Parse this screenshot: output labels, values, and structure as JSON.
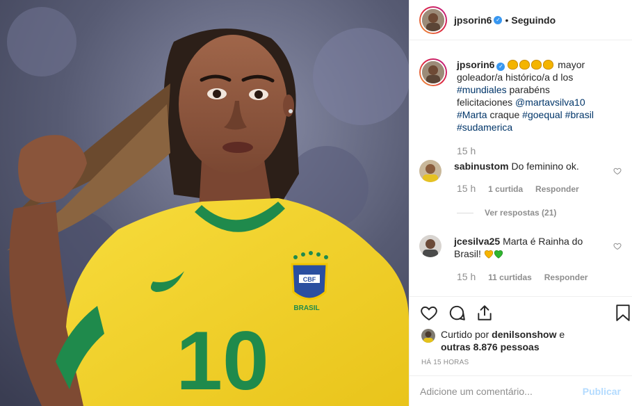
{
  "post": {
    "username": "jpsorin6",
    "verified_mark": "✓",
    "separator": "•",
    "follow_status": "Seguindo",
    "caption": {
      "username": "jpsorin6",
      "clap_count": 4,
      "text_1": " mayor goleador/a histórico/a d los ",
      "hashtag_mundiales": "#mundiales",
      "text_2": " parabéns felicitaciones ",
      "mention": "@martavsilva10",
      "hashtag_marta": " #Marta",
      "text_3": " craque ",
      "hashtag_goequal": "#goequal",
      "hashtag_brasil": " #brasil",
      "hashtag_sudamerica": " #sudamerica",
      "time": "15 h"
    }
  },
  "comments": [
    {
      "username": "sabinustom",
      "text": "Do feminino ok.",
      "time": "15 h",
      "likes": "1 curtida",
      "reply": "Responder",
      "view_replies": "Ver respostas (21)"
    },
    {
      "username": "jcesilva25",
      "text": "Marta é Rainha do Brasil!",
      "time": "15 h",
      "likes": "11 curtidas",
      "reply": "Responder"
    }
  ],
  "actions": {
    "liked_by_prefix": "Curtido por ",
    "liked_by_user": "denilsonshow",
    "liked_by_and": " e",
    "others": "outras 8.876 pessoas",
    "timestamp": "HÁ 15 HORAS"
  },
  "add_comment": {
    "placeholder": "Adicione um comentário...",
    "publish_label": "Publicar"
  },
  "photo": {
    "jersey_number": "10",
    "crest_text": "CBF",
    "brand_text": "BRASIL"
  },
  "colors": {
    "link": "#003569",
    "jersey_yellow": "#f5d42a",
    "jersey_green": "#1f8a4c",
    "publish_disabled": "#b3dbff"
  },
  "icons": [
    "heart-icon",
    "comment-icon",
    "share-icon",
    "bookmark-icon",
    "verified-icon",
    "clap-emoji-icon"
  ]
}
